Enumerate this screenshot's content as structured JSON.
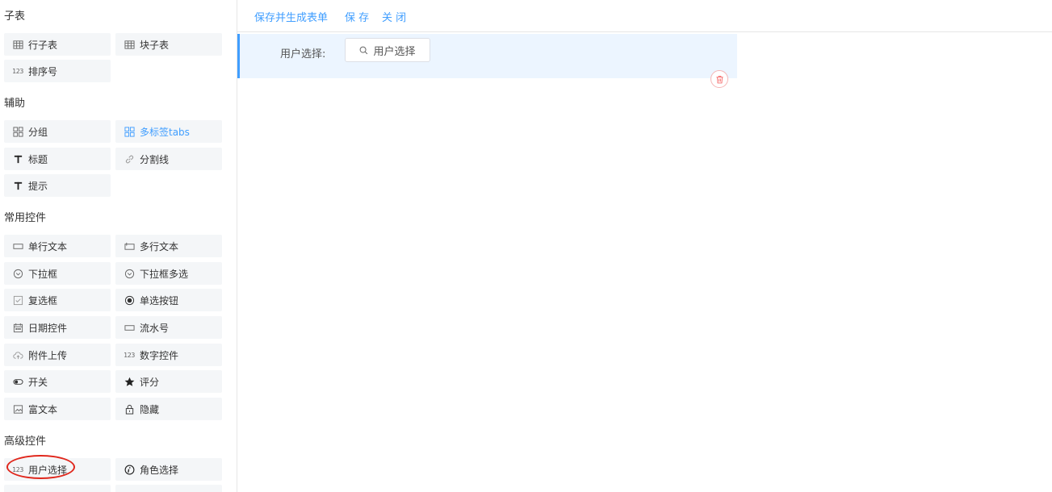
{
  "toolbar": {
    "save_generate": "保存并生成表单",
    "save": "保 存",
    "close": "关 闭"
  },
  "palette": {
    "groups": [
      {
        "title": "子表",
        "items": [
          {
            "label": "行子表",
            "icon": "table-icon"
          },
          {
            "label": "块子表",
            "icon": "table-icon"
          },
          {
            "label": "排序号",
            "icon": "number-123-icon"
          }
        ]
      },
      {
        "title": "辅助",
        "items": [
          {
            "label": "分组",
            "icon": "grid-icon"
          },
          {
            "label": "多标签tabs",
            "icon": "grid-icon",
            "active": true
          },
          {
            "label": "标题",
            "icon": "text-t-icon"
          },
          {
            "label": "分割线",
            "icon": "link-icon"
          },
          {
            "label": "提示",
            "icon": "text-t-icon"
          }
        ]
      },
      {
        "title": "常用控件",
        "items": [
          {
            "label": "单行文本",
            "icon": "input-icon"
          },
          {
            "label": "多行文本",
            "icon": "textarea-icon"
          },
          {
            "label": "下拉框",
            "icon": "chevron-circle-icon"
          },
          {
            "label": "下拉框多选",
            "icon": "chevron-circle-icon"
          },
          {
            "label": "复选框",
            "icon": "checkbox-icon"
          },
          {
            "label": "单选按钮",
            "icon": "radio-icon"
          },
          {
            "label": "日期控件",
            "icon": "calendar-icon"
          },
          {
            "label": "流水号",
            "icon": "input-icon"
          },
          {
            "label": "附件上传",
            "icon": "cloud-upload-icon"
          },
          {
            "label": "数字控件",
            "icon": "number-123-icon"
          },
          {
            "label": "开关",
            "icon": "toggle-icon"
          },
          {
            "label": "评分",
            "icon": "star-icon"
          },
          {
            "label": "富文本",
            "icon": "image-icon"
          },
          {
            "label": "隐藏",
            "icon": "lock-icon"
          }
        ]
      },
      {
        "title": "高级控件",
        "items": [
          {
            "label": "用户选择",
            "icon": "number-123-icon"
          },
          {
            "label": "角色选择",
            "icon": "info-icon"
          }
        ]
      }
    ],
    "number_glyph": "123"
  },
  "canvas": {
    "field_label": "用户选择:",
    "user_button_label": "用户选择"
  },
  "colors": {
    "accent": "#409eff",
    "highlight_bg": "#ecf5ff",
    "annotation_red": "#e0271c",
    "delete_red": "#f56c6c"
  }
}
